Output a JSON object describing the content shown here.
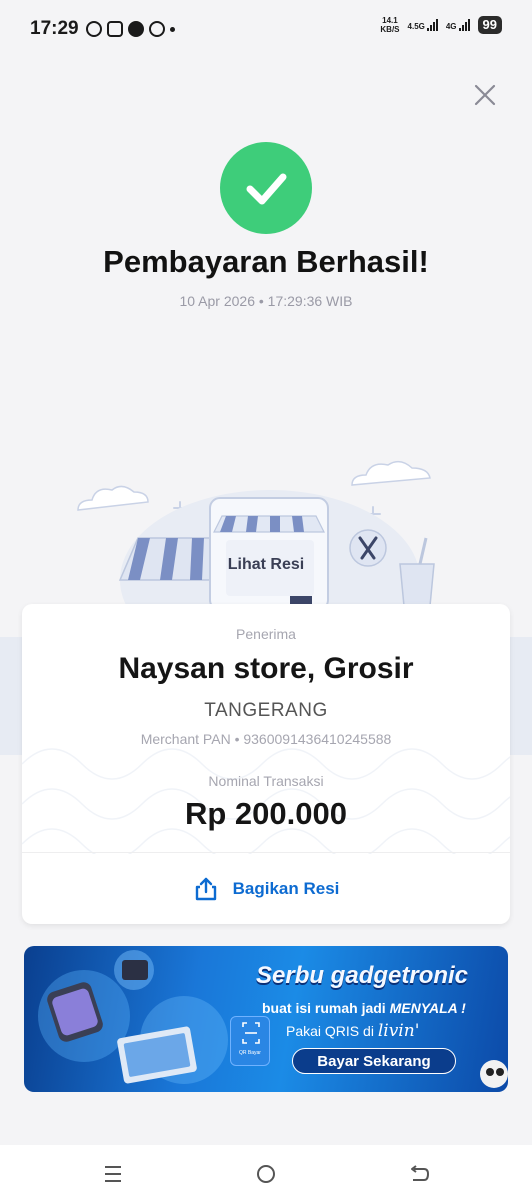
{
  "status_bar": {
    "time": "17:29",
    "net_speed": "14.1",
    "net_unit": "KB/S",
    "net1_label": "4.5G",
    "net2_label": "4G",
    "battery": "99"
  },
  "header": {
    "title": "Pembayaran Berhasil!",
    "timestamp": "10 Apr 2026 • 17:29:36 WIB"
  },
  "illustration": {
    "label": "Lihat Resi"
  },
  "receipt": {
    "recipient_label": "Penerima",
    "merchant_name": "Naysan store, Grosir",
    "city": "TANGERANG",
    "merchant_pan": "Merchant PAN • 9360091436410245588",
    "amount_label": "Nominal Transaksi",
    "amount": "Rp 200.000",
    "share_label": "Bagikan Resi"
  },
  "banner": {
    "headline": "Serbu gadgetronic",
    "line1_prefix": "buat isi rumah jadi ",
    "line1_highlight": "MENYALA !",
    "line2_prefix": "Pakai QRIS di ",
    "line2_brand": "livin'",
    "cta": "Bayar Sekarang",
    "qr_caption": "QR Bayar"
  },
  "colors": {
    "success": "#3ecd7a",
    "accent": "#0d6bd1",
    "banner": "#1a77d8"
  },
  "icons": {
    "close": "close-icon",
    "success": "check-icon",
    "share": "share-icon",
    "nav_menu": "menu-icon",
    "nav_home": "home-icon",
    "nav_back": "back-icon"
  }
}
